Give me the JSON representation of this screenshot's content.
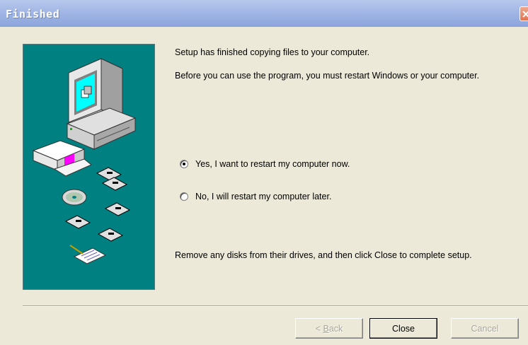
{
  "window": {
    "title": "Finished"
  },
  "content": {
    "line1": "Setup has finished copying files to your computer.",
    "line2": "Before you can use the program, you must restart Windows or your computer.",
    "footer_note": "Remove any disks from their drives, and then click Close to complete setup."
  },
  "options": [
    {
      "label": "Yes, I want to restart my computer now.",
      "selected": true
    },
    {
      "label": "No, I will restart my computer later.",
      "selected": false
    }
  ],
  "buttons": {
    "back_prefix": "< ",
    "back_mnemonic": "B",
    "back_rest": "ack",
    "close": "Close",
    "cancel": "Cancel"
  },
  "colors": {
    "art_background": "#008080",
    "dialog_background": "#ece9d8",
    "title_gradient": "#9db3e3"
  },
  "icons": [
    "close-icon",
    "computer-setup-illustration",
    "cd-icon",
    "floppy-disk-icon",
    "document-pen-icon"
  ]
}
